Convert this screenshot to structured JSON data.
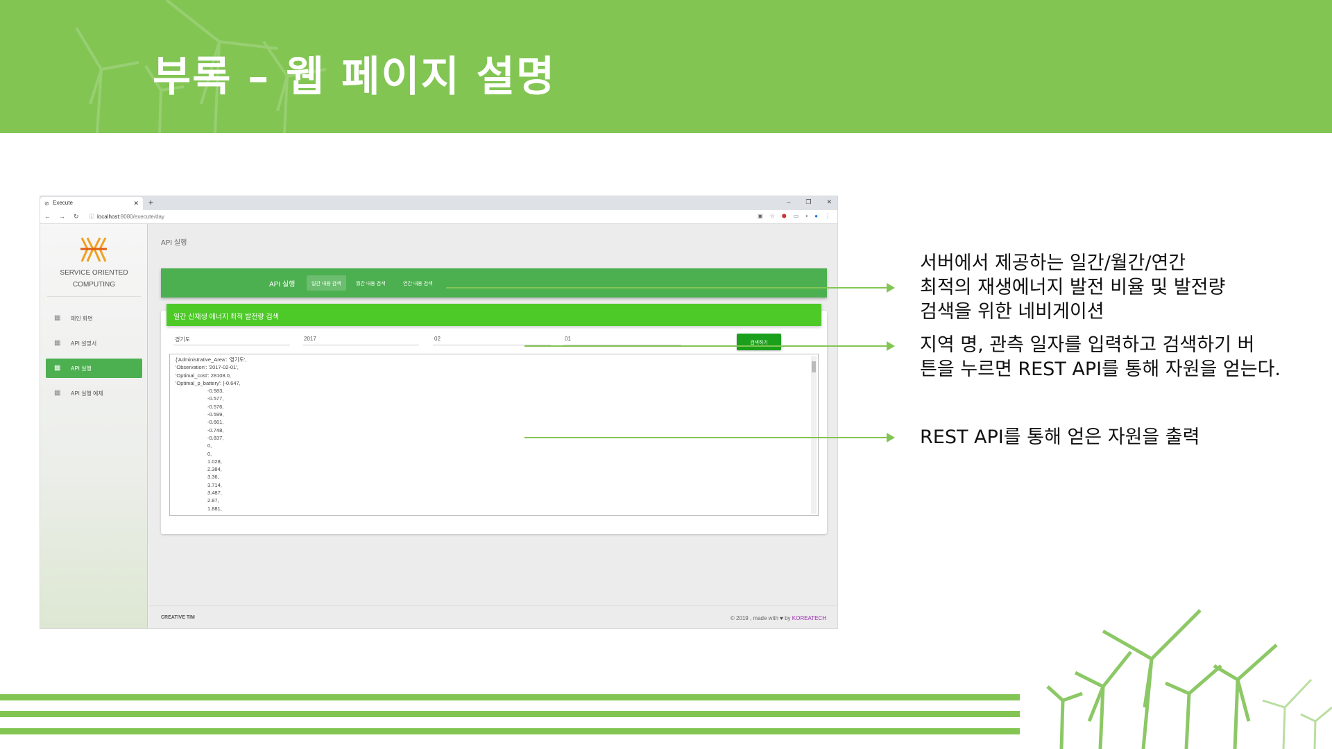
{
  "slide": {
    "title": "부록 – 웹 페이지 설명"
  },
  "browser": {
    "tab_title": "Execute",
    "url_host": "localhost",
    "url_rest": ":8080/execute/day"
  },
  "sidebar": {
    "logo_line1": "SERVICE ORIENTED",
    "logo_line2": "COMPUTING",
    "items": [
      {
        "label": "메인 화면"
      },
      {
        "label": "API 설명서"
      },
      {
        "label": "API 실행"
      },
      {
        "label": "API 실행 예제"
      }
    ]
  },
  "page": {
    "breadcrumb": "API 실행",
    "topnav": {
      "brand": "API 실행",
      "links": [
        "일간 내용 검색",
        "월간 내용 검색",
        "연간 내용 검색"
      ]
    },
    "card_title": "일간 신재생 에너지 최적 발전량 검색",
    "fields": {
      "region": "경기도",
      "year": "2017",
      "month": "02",
      "day": "01"
    },
    "search_button": "검색하기",
    "result_lines": [
      "{'Administrative_Area': '경기도',",
      "'Observation': '2017-02-01',",
      "'Optimal_cost': 28108.0,",
      "'Optimal_p_battery': [-0.647,"
    ],
    "result_values": [
      "-0.583,",
      "-0.577,",
      "-0.576,",
      "-0.599,",
      "-0.661,",
      "-0.748,",
      "-0.837,",
      "0,",
      "0,",
      "1.028,",
      "2.384,",
      "3.36,",
      "3.714,",
      "3.487,",
      "2.87,",
      "1.881,"
    ],
    "footer_left": "CREATIVE TIM",
    "footer_right_prefix": "© 2019 , made with",
    "footer_right_by": "by",
    "footer_right_brand": "KOREATECH"
  },
  "annotations": {
    "note1": [
      "서버에서 제공하는 일간/월간/연간",
      "최적의 재생에너지 발전 비율 및 발전량",
      "검색을 위한 네비게이션"
    ],
    "note2": [
      "지역 명, 관측 일자를 입력하고 검색하기 버",
      "튼을 누르면 REST API를 통해 자원을 얻는다."
    ],
    "note3": "REST API를 통해 얻은 자원을 출력"
  },
  "colors": {
    "accent_green": "#82c553",
    "nav_green": "#4caf50",
    "card_header_green": "#4dc928"
  },
  "icons": {
    "tab_favicon": "globe-icon",
    "sidebar_item": "dashboard-icon",
    "footer_heart": "heart-icon"
  }
}
